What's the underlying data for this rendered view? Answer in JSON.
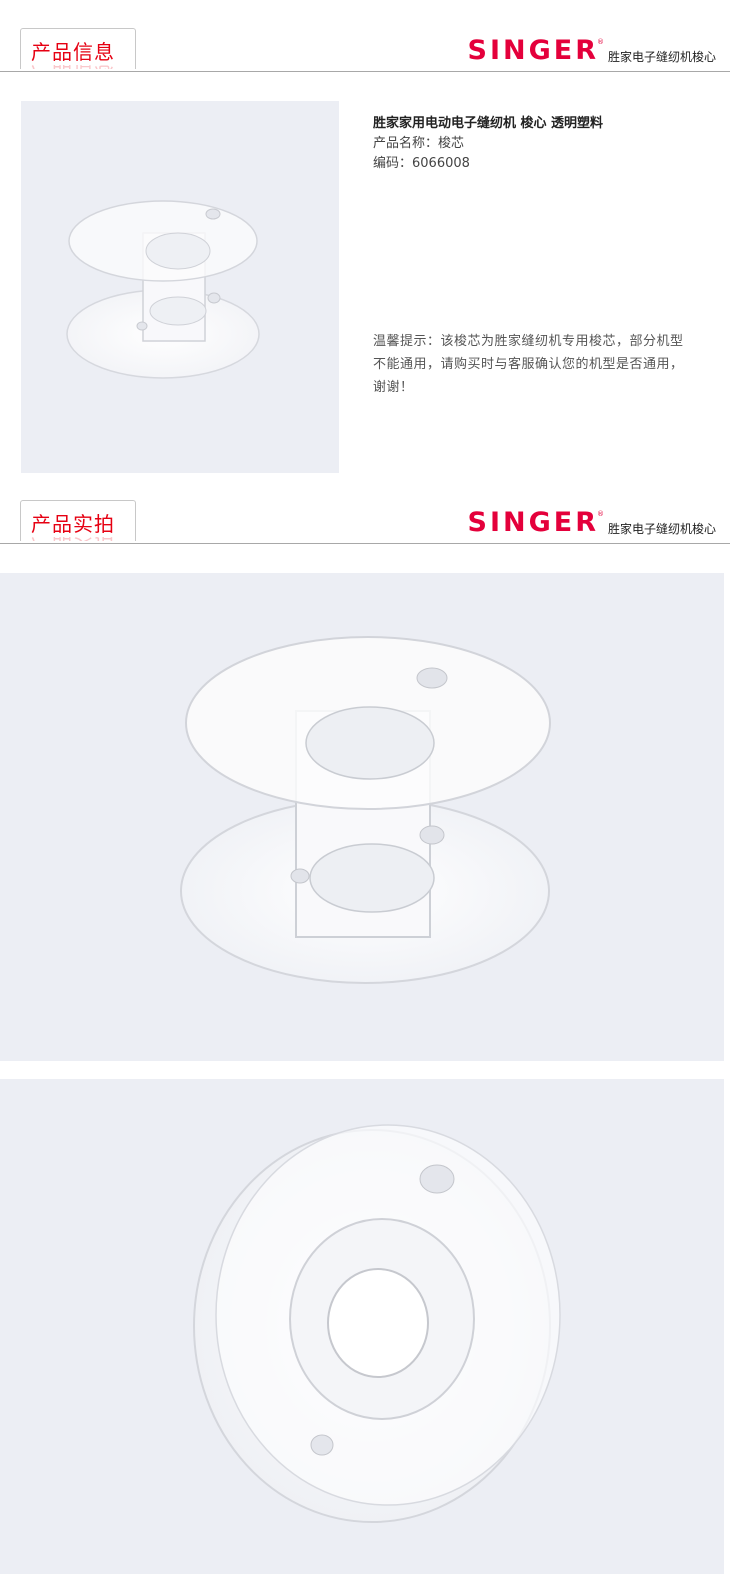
{
  "sections": [
    {
      "title": "产品信息",
      "brand": "SINGER",
      "brand_mark": "®",
      "brand_subtitle": "胜家电子缝纫机梭心"
    },
    {
      "title": "产品实拍",
      "brand": "SINGER",
      "brand_mark": "®",
      "brand_subtitle": "胜家电子缝纫机梭心"
    }
  ],
  "product": {
    "title": "胜家家用电动电子缝纫机  梭心 透明塑料",
    "name_line": "产品名称：梭芯",
    "code_line": "编码：6066008",
    "note": "温馨提示：该梭芯为胜家缝纫机专用梭芯，部分机型不能通用，请购买时与客服确认您的机型是否通用，谢谢！"
  },
  "colors": {
    "accent_red": "#e60012",
    "brand_red": "#e4003b",
    "photo_bg": "#eceef4"
  },
  "images": [
    {
      "name": "bobbin-side-small-image",
      "alt": "clear plastic bobbin, side view"
    },
    {
      "name": "bobbin-side-large-image",
      "alt": "clear plastic bobbin, side view"
    },
    {
      "name": "bobbin-top-image",
      "alt": "clear plastic bobbin, top view"
    }
  ]
}
